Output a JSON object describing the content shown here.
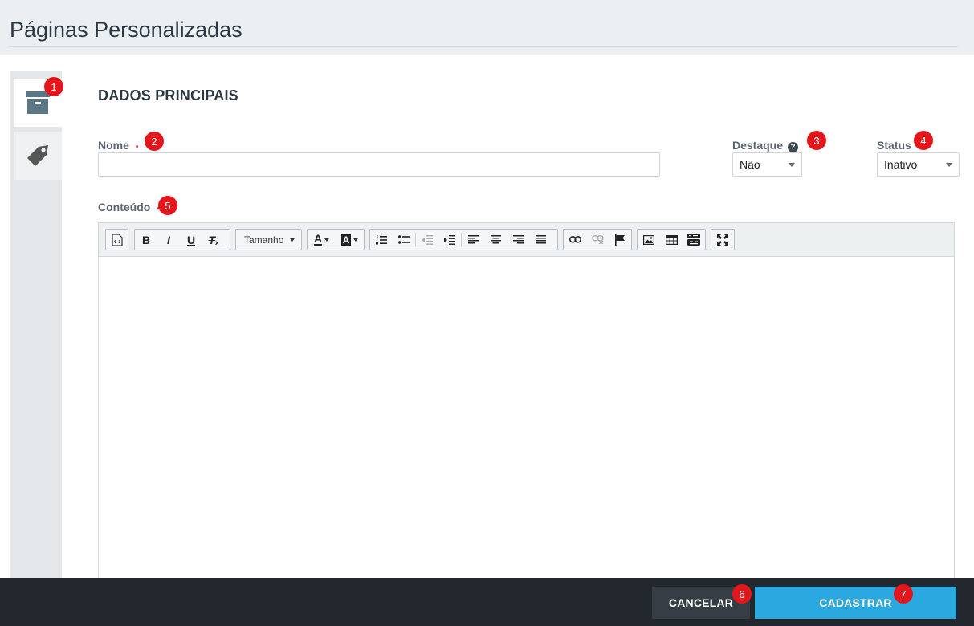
{
  "header": {
    "title": "Páginas Personalizadas"
  },
  "sidebar": {
    "tabs": [
      {
        "icon": "archive-box-icon",
        "active": true
      },
      {
        "icon": "tag-icon",
        "active": false
      }
    ]
  },
  "badges": [
    "1",
    "2",
    "3",
    "4",
    "5",
    "6",
    "7"
  ],
  "form": {
    "section_title": "DADOS PRINCIPAIS",
    "nome": {
      "label": "Nome",
      "required_mark": "•",
      "value": ""
    },
    "destaque": {
      "label": "Destaque",
      "help_glyph": "?",
      "selected": "Não"
    },
    "status": {
      "label": "Status",
      "selected": "Inativo"
    },
    "conteudo": {
      "label": "Conteúdo",
      "required_mark": "•"
    }
  },
  "editor": {
    "toolbar": {
      "size_dropdown": "Tamanho",
      "bold": "B",
      "italic": "I",
      "underline": "U",
      "clear_format": "T",
      "font_color": "A",
      "bg_color": "A"
    }
  },
  "footer": {
    "cancel_label": "CANCELAR",
    "submit_label": "CADASTRAR"
  },
  "colors": {
    "accent": "#2aa9e0",
    "badge": "#e3161c",
    "footer_bg": "#22282e",
    "icon_slate": "#5b7786"
  }
}
